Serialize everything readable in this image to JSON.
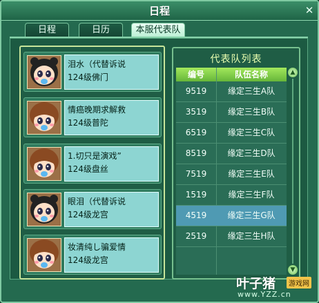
{
  "window": {
    "title": "日程",
    "close_glyph": "✕"
  },
  "tabs": [
    {
      "label": "日程",
      "active": false
    },
    {
      "label": "日历",
      "active": false
    },
    {
      "label": "本服代表队",
      "active": true
    }
  ],
  "members": [
    {
      "name": "泪水（代替诉说",
      "level": "124级佛门",
      "avatar": "panda-hood-girl-avatar"
    },
    {
      "name": "情癌晚期求解救",
      "level": "124级普陀",
      "avatar": "brown-hair-girl-avatar"
    },
    {
      "name": "1.切只是演戏”",
      "level": "124级盘丝",
      "avatar": "brown-hair-girl-avatar"
    },
    {
      "name": "眼泪（代替诉说",
      "level": "124级龙宫",
      "avatar": "panda-hood-girl-avatar"
    },
    {
      "name": "妆清纯し骗爱情",
      "level": "124级龙宫",
      "avatar": "brown-hair-girl-avatar"
    }
  ],
  "team_list": {
    "title": "代表队列表",
    "columns": [
      "编号",
      "队伍名称"
    ],
    "rows": [
      {
        "id": "9519",
        "name": "缘定三生A队",
        "selected": false
      },
      {
        "id": "3519",
        "name": "缘定三生B队",
        "selected": false
      },
      {
        "id": "6519",
        "name": "缘定三生C队",
        "selected": false
      },
      {
        "id": "8519",
        "name": "缘定三生D队",
        "selected": false
      },
      {
        "id": "7519",
        "name": "缘定三生E队",
        "selected": false
      },
      {
        "id": "1519",
        "name": "缘定三生F队",
        "selected": false
      },
      {
        "id": "4519",
        "name": "缘定三生G队",
        "selected": true
      },
      {
        "id": "2519",
        "name": "缘定三生H队",
        "selected": false
      }
    ]
  },
  "watermark": {
    "brand": "叶子猪",
    "badge": "游戏网",
    "url": "www.YZZ.cn"
  }
}
